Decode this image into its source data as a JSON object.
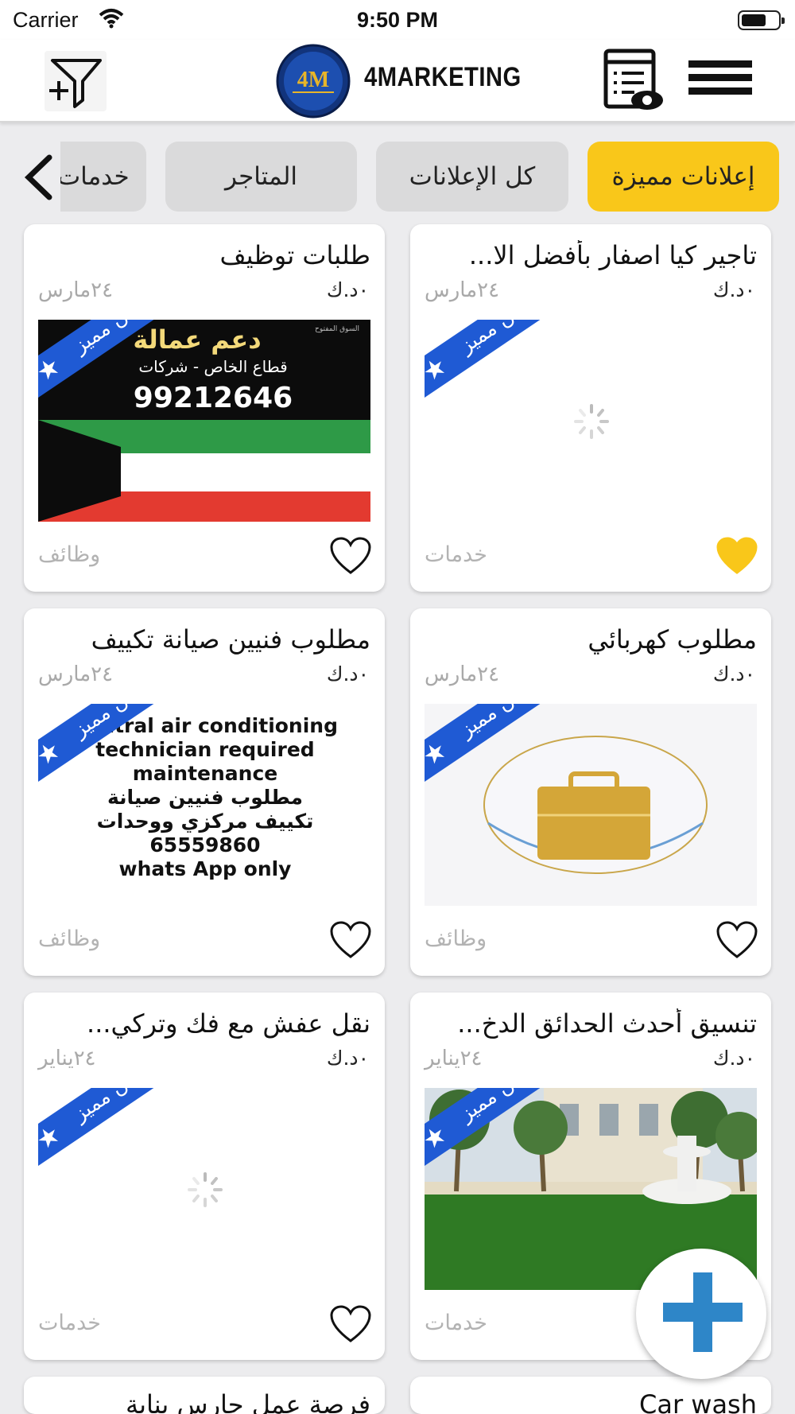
{
  "status_bar": {
    "carrier": "Carrier",
    "time": "9:50 PM"
  },
  "header": {
    "brand": "4MARKETING",
    "logo_text": "4M"
  },
  "tabs": [
    {
      "label": "إعلانات مميزة",
      "active": true
    },
    {
      "label": "كل الإعلانات",
      "active": false
    },
    {
      "label": "المتاجر",
      "active": false
    },
    {
      "label": "خدمات",
      "active": false
    }
  ],
  "ribbon_label": "إعلان مميز",
  "listings": [
    {
      "title": "تاجير كيا اصفار بأفضل الا...",
      "price": "٠د.ك",
      "date": "٢٤مارس",
      "category": "خدمات",
      "favorited": true,
      "image": "loading"
    },
    {
      "title": "طلبات توظيف",
      "price": "٠د.ك",
      "date": "٢٤مارس",
      "category": "وظائف",
      "favorited": false,
      "image": "kuwait-flag-ad",
      "image_text": {
        "line1": "دعم عمالة",
        "line2": "قطاع الخاص - شركات",
        "phone": "99212646",
        "watermark": "السوق المفتوح"
      }
    },
    {
      "title": "مطلوب كهربائي",
      "price": "٠د.ك",
      "date": "٢٤مارس",
      "category": "وظائف",
      "favorited": false,
      "image": "briefcase"
    },
    {
      "title": "مطلوب فنيين صيانة تكييف",
      "price": "٠د.ك",
      "date": "٢٤مارس",
      "category": "وظائف",
      "favorited": false,
      "image": "text-ad",
      "image_text": {
        "l1": "Central air conditioning",
        "l2": "technician required",
        "l3": "maintenance",
        "l4": "مطلوب فنيين صيانة",
        "l5": "تكييف مركزي ووحدات",
        "l6": "65559860",
        "l7": "whats App only"
      }
    },
    {
      "title": "تنسيق أحدث الحدائق الدخ...",
      "price": "٠د.ك",
      "date": "٢٤يناير",
      "category": "خدمات",
      "favorited": false,
      "image": "garden"
    },
    {
      "title": "نقل عفش مع فك وتركي...",
      "price": "٠د.ك",
      "date": "٢٤يناير",
      "category": "خدمات",
      "favorited": false,
      "image": "loading"
    },
    {
      "title": "Car wash",
      "price": "",
      "date": "",
      "category": "",
      "favorited": false,
      "image": ""
    },
    {
      "title": "فرصة عمل حارس بناية",
      "price": "",
      "date": "",
      "category": "",
      "favorited": false,
      "image": ""
    }
  ],
  "colors": {
    "accent": "#f9c71a",
    "ribbon": "#1f5ad4",
    "fab": "#2e86c8"
  }
}
